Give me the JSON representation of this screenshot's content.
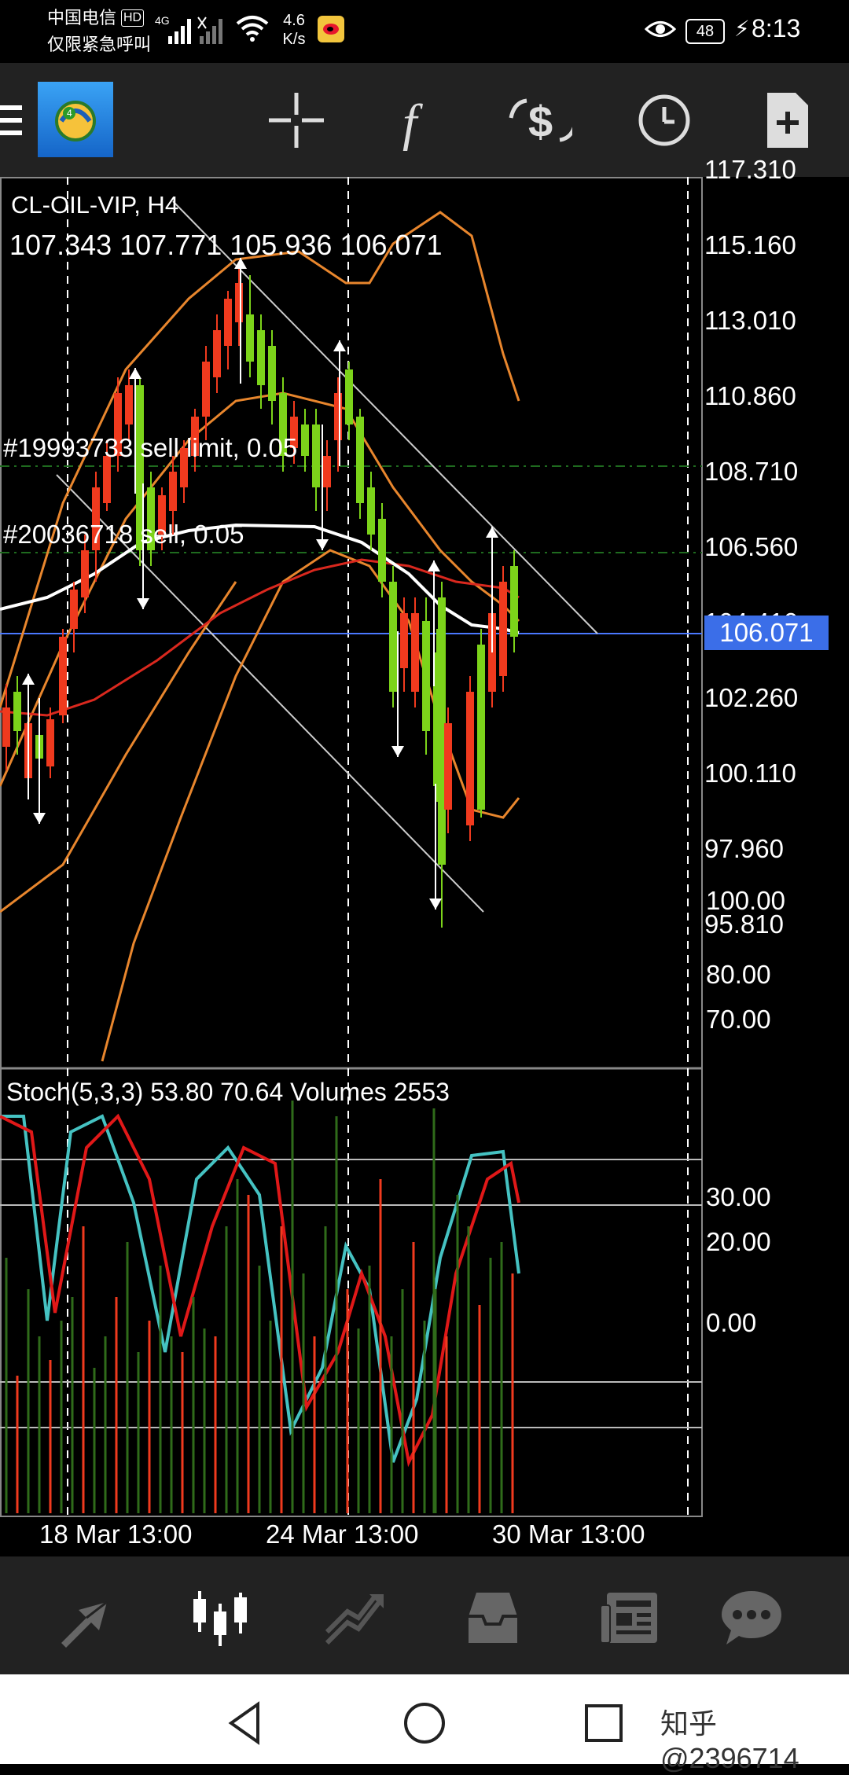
{
  "status_bar": {
    "carrier": "中国电信",
    "hd_badge": "HD",
    "network": "4G",
    "emergency": "仅限紧急呼叫",
    "speed_value": "4.6",
    "speed_unit": "K/s",
    "battery": "48",
    "time": "8:13",
    "icons": [
      "signal-icon",
      "wifi-icon",
      "weibo-icon",
      "eye-icon",
      "battery-icon",
      "charging-icon"
    ]
  },
  "toolbar": {
    "icons": [
      "menu-icon",
      "app-logo",
      "crosshair-icon",
      "function-icon",
      "trade-icon",
      "clock-icon",
      "new-document-icon"
    ]
  },
  "chart": {
    "symbol_line": "CL-OIL-VIP, H4",
    "ohlc_line": "107.343 107.771 105.936 106.071",
    "order1": "#19993733 sell limit, 0.05",
    "order2": "#20036718 sell, 0.05",
    "price_labels": [
      "117.310",
      "115.160",
      "113.010",
      "110.860",
      "108.710",
      "106.560",
      "104.410",
      "102.260",
      "100.110",
      "97.960",
      "95.810"
    ],
    "current_price": "106.071",
    "stoch_line": "Stoch(5,3,3) 53.80 70.64 Volumes 2553",
    "stoch_labels": [
      "100.00",
      "80.00",
      "70.00",
      "30.00",
      "20.00",
      "0.00"
    ],
    "date_labels": [
      "18 Mar 13:00",
      "24 Mar 13:00",
      "30 Mar 13:00"
    ],
    "colors": {
      "bull": "#7cd31a",
      "bear": "#f03a1e",
      "bollinger": "#e8862d",
      "ma_white": "#ffffff",
      "ma_red": "#d9281e",
      "price_line": "#4a78ff",
      "price_tag": "#3b6ee8",
      "stoch_main": "#45c2c2",
      "stoch_signal": "#e01818",
      "order_line": "#1f6b1f"
    }
  },
  "bottom_bar": {
    "icons": [
      "quotes-icon",
      "chart-icon",
      "trade-icon",
      "history-icon",
      "news-icon",
      "chat-icon"
    ]
  },
  "nav_bar": {
    "watermark": "知乎 @2396714",
    "icons": [
      "back-icon",
      "home-icon",
      "recents-icon"
    ]
  }
}
